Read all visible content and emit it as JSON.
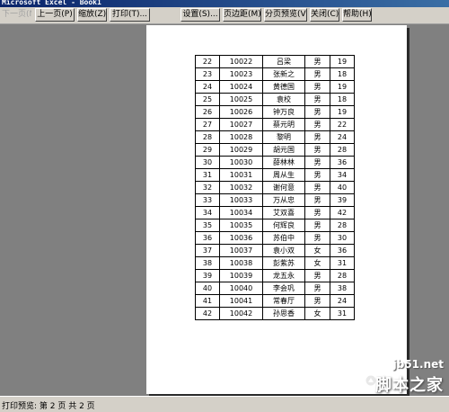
{
  "window": {
    "title": "Microsoft Excel - Book1"
  },
  "toolbar": {
    "next": "下一页(N)",
    "prev": "上一页(P)",
    "zoom": "缩放(Z)",
    "print": "打印(T)...",
    "setup": "设置(S)...",
    "margins": "页边距(M)",
    "page_break": "分页预览(V)",
    "close": "关闭(C)",
    "help": "帮助(H)"
  },
  "table": {
    "rows": [
      [
        "22",
        "10022",
        "吕梁",
        "男",
        "19"
      ],
      [
        "23",
        "10023",
        "张新之",
        "男",
        "18"
      ],
      [
        "24",
        "10024",
        "黄德国",
        "男",
        "19"
      ],
      [
        "25",
        "10025",
        "袁校",
        "男",
        "18"
      ],
      [
        "26",
        "10026",
        "钟万良",
        "男",
        "19"
      ],
      [
        "27",
        "10027",
        "蔡元明",
        "男",
        "22"
      ],
      [
        "28",
        "10028",
        "黎明",
        "男",
        "24"
      ],
      [
        "29",
        "10029",
        "胡元国",
        "男",
        "28"
      ],
      [
        "30",
        "10030",
        "薛林林",
        "男",
        "36"
      ],
      [
        "31",
        "10031",
        "周从生",
        "男",
        "34"
      ],
      [
        "32",
        "10032",
        "谢何意",
        "男",
        "40"
      ],
      [
        "33",
        "10033",
        "万从忠",
        "男",
        "39"
      ],
      [
        "34",
        "10034",
        "艾双喜",
        "男",
        "42"
      ],
      [
        "35",
        "10035",
        "何辉良",
        "男",
        "28"
      ],
      [
        "36",
        "10036",
        "苏伯中",
        "男",
        "30"
      ],
      [
        "37",
        "10037",
        "袁小双",
        "女",
        "36"
      ],
      [
        "38",
        "10038",
        "彭紫苏",
        "女",
        "31"
      ],
      [
        "39",
        "10039",
        "龙五永",
        "男",
        "28"
      ],
      [
        "40",
        "10040",
        "李会巩",
        "男",
        "38"
      ],
      [
        "41",
        "10041",
        "常春厅",
        "男",
        "24"
      ],
      [
        "42",
        "10042",
        "孙思香",
        "女",
        "31"
      ]
    ]
  },
  "status": {
    "text": "打印预览: 第 2 页  共 2 页"
  },
  "watermark": {
    "url": "jb51.net",
    "name": "脚本之家"
  }
}
